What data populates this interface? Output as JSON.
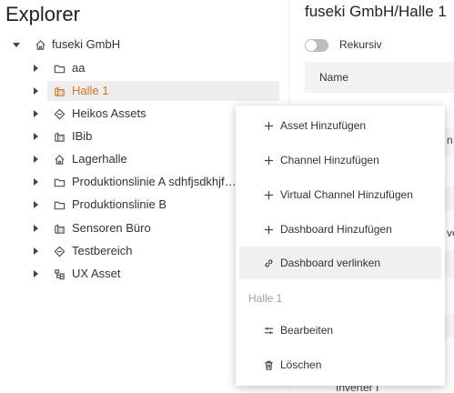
{
  "explorer": {
    "title": "Explorer",
    "root": {
      "label": "fuseki GmbH",
      "icon": "home-icon",
      "expanded": true
    },
    "children": [
      {
        "label": "aa",
        "icon": "folder-icon"
      },
      {
        "label": "Halle 1",
        "icon": "building-icon",
        "selected": true
      },
      {
        "label": "Heikos Assets",
        "icon": "diamond-icon"
      },
      {
        "label": "IBib",
        "icon": "building-icon"
      },
      {
        "label": "Lagerhalle",
        "icon": "home-icon"
      },
      {
        "label": "Produktionslinie A sdhfjsdkhjf…",
        "icon": "folder-icon"
      },
      {
        "label": "Produktionslinie B",
        "icon": "folder-icon"
      },
      {
        "label": "Sensoren Büro",
        "icon": "building-icon"
      },
      {
        "label": "Testbereich",
        "icon": "diamond-icon"
      },
      {
        "label": "UX Asset",
        "icon": "hierarchy-icon"
      }
    ]
  },
  "right_panel": {
    "title": "fuseki GmbH/Halle 1",
    "toggle_label": "Rekursiv",
    "table_header": "Name",
    "partial_rows": [
      "n",
      "ve",
      "Inverter I"
    ]
  },
  "context_menu": {
    "items": [
      {
        "label": "Asset Hinzufügen",
        "icon": "plus-icon"
      },
      {
        "label": "Channel Hinzufügen",
        "icon": "plus-icon"
      },
      {
        "label": "Virtual Channel Hinzufügen",
        "icon": "plus-icon"
      },
      {
        "label": "Dashboard Hinzufügen",
        "icon": "plus-icon"
      },
      {
        "label": "Dashboard verlinken",
        "icon": "link-icon",
        "hover": true
      }
    ],
    "section_label": "Halle 1",
    "section_items": [
      {
        "label": "Bearbeiten",
        "icon": "sliders-icon"
      },
      {
        "label": "Löschen",
        "icon": "trash-icon"
      }
    ]
  },
  "colors": {
    "selected_text": "#d87320",
    "selected_background": "#eeeeee",
    "menu_hover": "#f0f0f0",
    "section_label": "#9e9e9e"
  }
}
